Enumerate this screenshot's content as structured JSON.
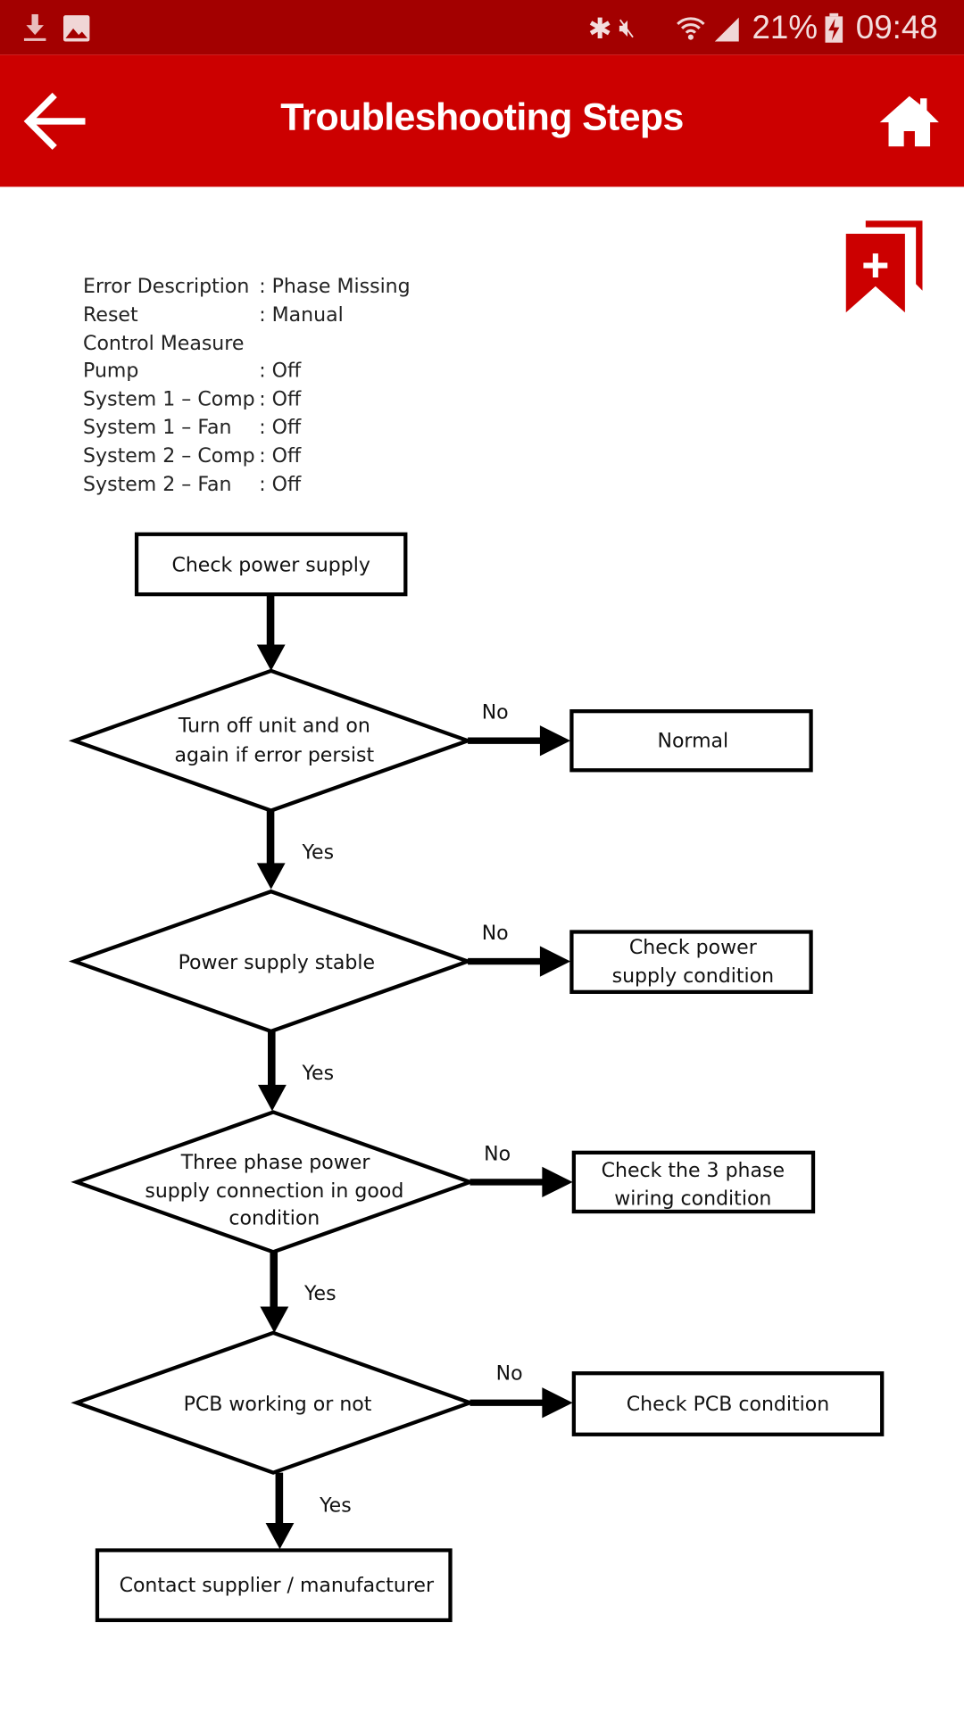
{
  "status_bar": {
    "icons_left": [
      "download-icon",
      "gallery-icon"
    ],
    "icons_right": [
      "bluetooth-icon",
      "vibrate-mute-icon",
      "wifi-icon",
      "signal-icon",
      "battery-charging-icon"
    ],
    "battery": "21%",
    "time": "09:48"
  },
  "app_bar": {
    "title": "Troubleshooting Steps",
    "back_icon": "arrow-left-icon",
    "home_icon": "home-icon"
  },
  "bookmark_icon": "bookmark-add-icon",
  "colors": {
    "status_bar": "#a30000",
    "app_bar": "#cc0000",
    "accent": "#cc0000"
  },
  "info": [
    {
      "label": "Error Description",
      "value": ": Phase Missing"
    },
    {
      "label": "Reset",
      "value": ": Manual"
    },
    {
      "label": "Control Measure",
      "value": ""
    },
    {
      "label": "Pump",
      "value": ": Off"
    },
    {
      "label": "System 1 – Comp",
      "value": ": Off"
    },
    {
      "label": "System 1 – Fan",
      "value": ": Off"
    },
    {
      "label": "System 2 – Comp",
      "value": ": Off"
    },
    {
      "label": "System 2 – Fan",
      "value": ": Off"
    }
  ],
  "flowchart": {
    "start": "Check power supply",
    "decisions": [
      {
        "lines": [
          "Turn off unit and on",
          "again if error persist"
        ],
        "no_label": "No",
        "no_action": [
          "Normal"
        ],
        "yes_label": "Yes"
      },
      {
        "lines": [
          "Power supply stable"
        ],
        "no_label": "No",
        "no_action": [
          "Check power",
          "supply condition"
        ],
        "yes_label": "Yes"
      },
      {
        "lines": [
          "Three phase power",
          "supply connection in good",
          "condition"
        ],
        "no_label": "No",
        "no_action": [
          "Check the 3 phase",
          "wiring condition"
        ],
        "yes_label": "Yes"
      },
      {
        "lines": [
          "PCB working or not"
        ],
        "no_label": "No",
        "no_action": [
          "Check PCB condition"
        ],
        "yes_label": "Yes"
      }
    ],
    "end": "Contact supplier / manufacturer"
  }
}
